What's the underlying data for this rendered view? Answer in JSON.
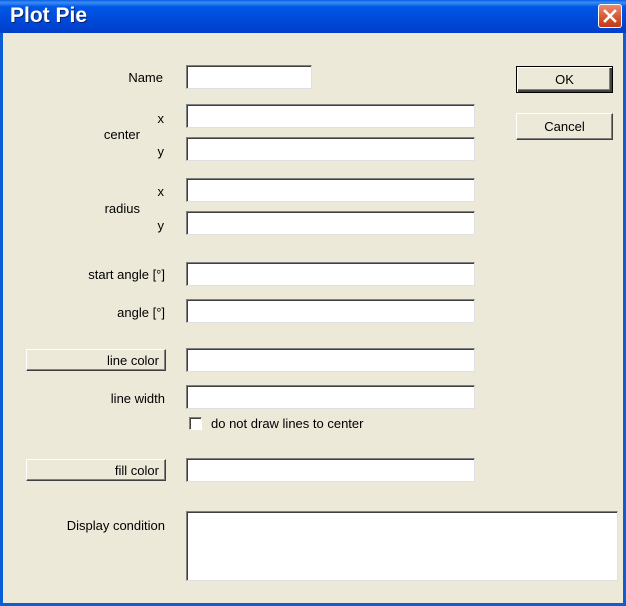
{
  "window": {
    "title": "Plot Pie"
  },
  "name": {
    "label": "Name",
    "value": ""
  },
  "center": {
    "label": "center",
    "x_label": "x",
    "y_label": "y",
    "x_value": "",
    "y_value": ""
  },
  "radius": {
    "label": "radius",
    "x_label": "x",
    "y_label": "y",
    "x_value": "",
    "y_value": ""
  },
  "start_angle": {
    "label": "start angle [°]",
    "value": ""
  },
  "angle": {
    "label": "angle [°]",
    "value": ""
  },
  "line_color": {
    "button_label": "line color",
    "value": ""
  },
  "line_width": {
    "label": "line width",
    "value": ""
  },
  "no_center_lines": {
    "label": "do not draw lines to center",
    "checked": false
  },
  "fill_color": {
    "button_label": "fill color",
    "value": ""
  },
  "display_condition": {
    "label": "Display condition",
    "value": ""
  },
  "buttons": {
    "ok": "OK",
    "cancel": "Cancel"
  },
  "colors": {
    "titlebar": "#0054e3",
    "dialog_bg": "#ece9d8",
    "close": "#d4542e"
  },
  "icons": {
    "close": "close-icon"
  }
}
